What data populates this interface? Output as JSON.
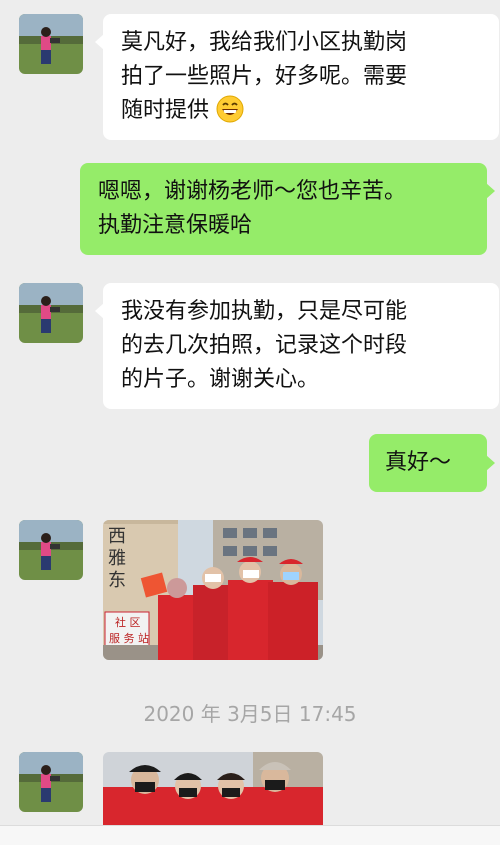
{
  "messages": [
    {
      "side": "left",
      "lines": [
        "莫凡好，我给我们小区执勤岗",
        "拍了一些照片，好多呢。需要",
        "随时提供"
      ],
      "emoji": "grinning-face-emoji"
    },
    {
      "side": "right",
      "lines": [
        "嗯嗯，谢谢杨老师～您也辛苦。",
        "执勤注意保暖哈"
      ]
    },
    {
      "side": "left",
      "lines": [
        "我没有参加执勤，只是尽可能",
        "的去几次拍照，记录这个时段",
        "的片子。谢谢关心。"
      ]
    },
    {
      "side": "right",
      "lines": [
        "真好～"
      ]
    }
  ],
  "photo1": {
    "sign_chars": [
      "西",
      "雅",
      "东"
    ],
    "sign2": "社 区",
    "sign3": "服 务 站"
  },
  "timestamp": "2020 年 3月5日 17:45",
  "colors": {
    "background": "#ededed",
    "bubble_left": "#ffffff",
    "bubble_right": "#95ec69",
    "timestamp": "#a6a6a6",
    "vest_red": "#d8262d"
  }
}
